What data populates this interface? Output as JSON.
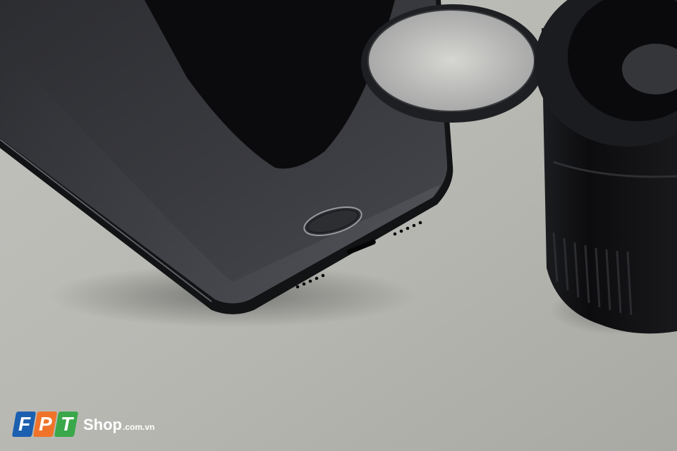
{
  "watermark": {
    "letters": [
      "F",
      "P",
      "T"
    ],
    "name": "Shop",
    "domain": ".com.vn",
    "colors": {
      "f": "#1b5fb0",
      "p": "#f0732a",
      "t": "#3aa84a",
      "text": "#ffffff"
    }
  },
  "scene": {
    "background": "#b4b4af",
    "phone_color": "#1c1d20",
    "lens_color": "#111214",
    "filter_ring_color": "#1e1f22"
  }
}
